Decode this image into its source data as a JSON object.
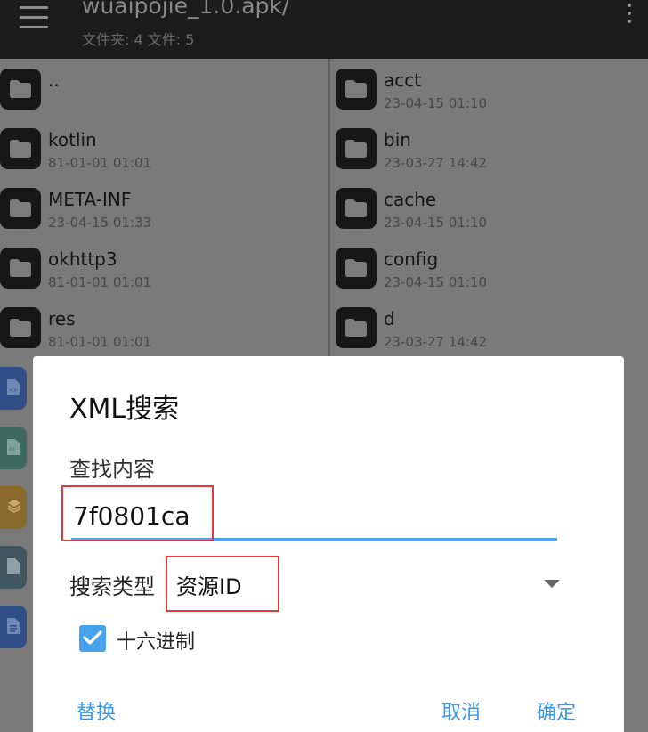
{
  "header": {
    "title": "wuaipojie_1.0.apk/",
    "subtitle": "文件夹: 4  文件: 5"
  },
  "left_pane": {
    "folders": [
      {
        "name": "..",
        "date": ""
      },
      {
        "name": "kotlin",
        "date": "81-01-01 01:01"
      },
      {
        "name": "META-INF",
        "date": "23-04-15 01:33"
      },
      {
        "name": "okhttp3",
        "date": "81-01-01 01:01"
      },
      {
        "name": "res",
        "date": "81-01-01 01:01"
      }
    ],
    "file_icons": [
      {
        "icon": "xml-file-icon",
        "color": "#2f4f86"
      },
      {
        "icon": "binary-file-icon",
        "color": "#3d6a5c"
      },
      {
        "icon": "layers-file-icon",
        "color": "#8a6a2c"
      },
      {
        "icon": "document-file-icon",
        "color": "#3f5560"
      },
      {
        "icon": "text-file-icon",
        "color": "#2f4f86"
      }
    ]
  },
  "right_pane": {
    "folders": [
      {
        "name": "acct",
        "date": "23-04-15 01:10"
      },
      {
        "name": "bin",
        "date": "23-03-27 14:42"
      },
      {
        "name": "cache",
        "date": "23-04-15 01:10"
      },
      {
        "name": "config",
        "date": "23-04-15 01:10"
      },
      {
        "name": "d",
        "date": "23-03-27 14:42"
      }
    ]
  },
  "dialog": {
    "title": "XML搜索",
    "find_label": "查找内容",
    "find_value": "7f0801ca",
    "search_type_label": "搜索类型",
    "search_type_value": "资源ID",
    "hex_checkbox_label": "十六进制",
    "hex_checked": true,
    "replace_button": "替换",
    "cancel_button": "取消",
    "confirm_button": "确定"
  },
  "colors": {
    "accent": "#47a2ee",
    "highlight_box": "#e0393e",
    "appbar": "#1c1c1c",
    "scrim_background": "#7a7a7a"
  }
}
